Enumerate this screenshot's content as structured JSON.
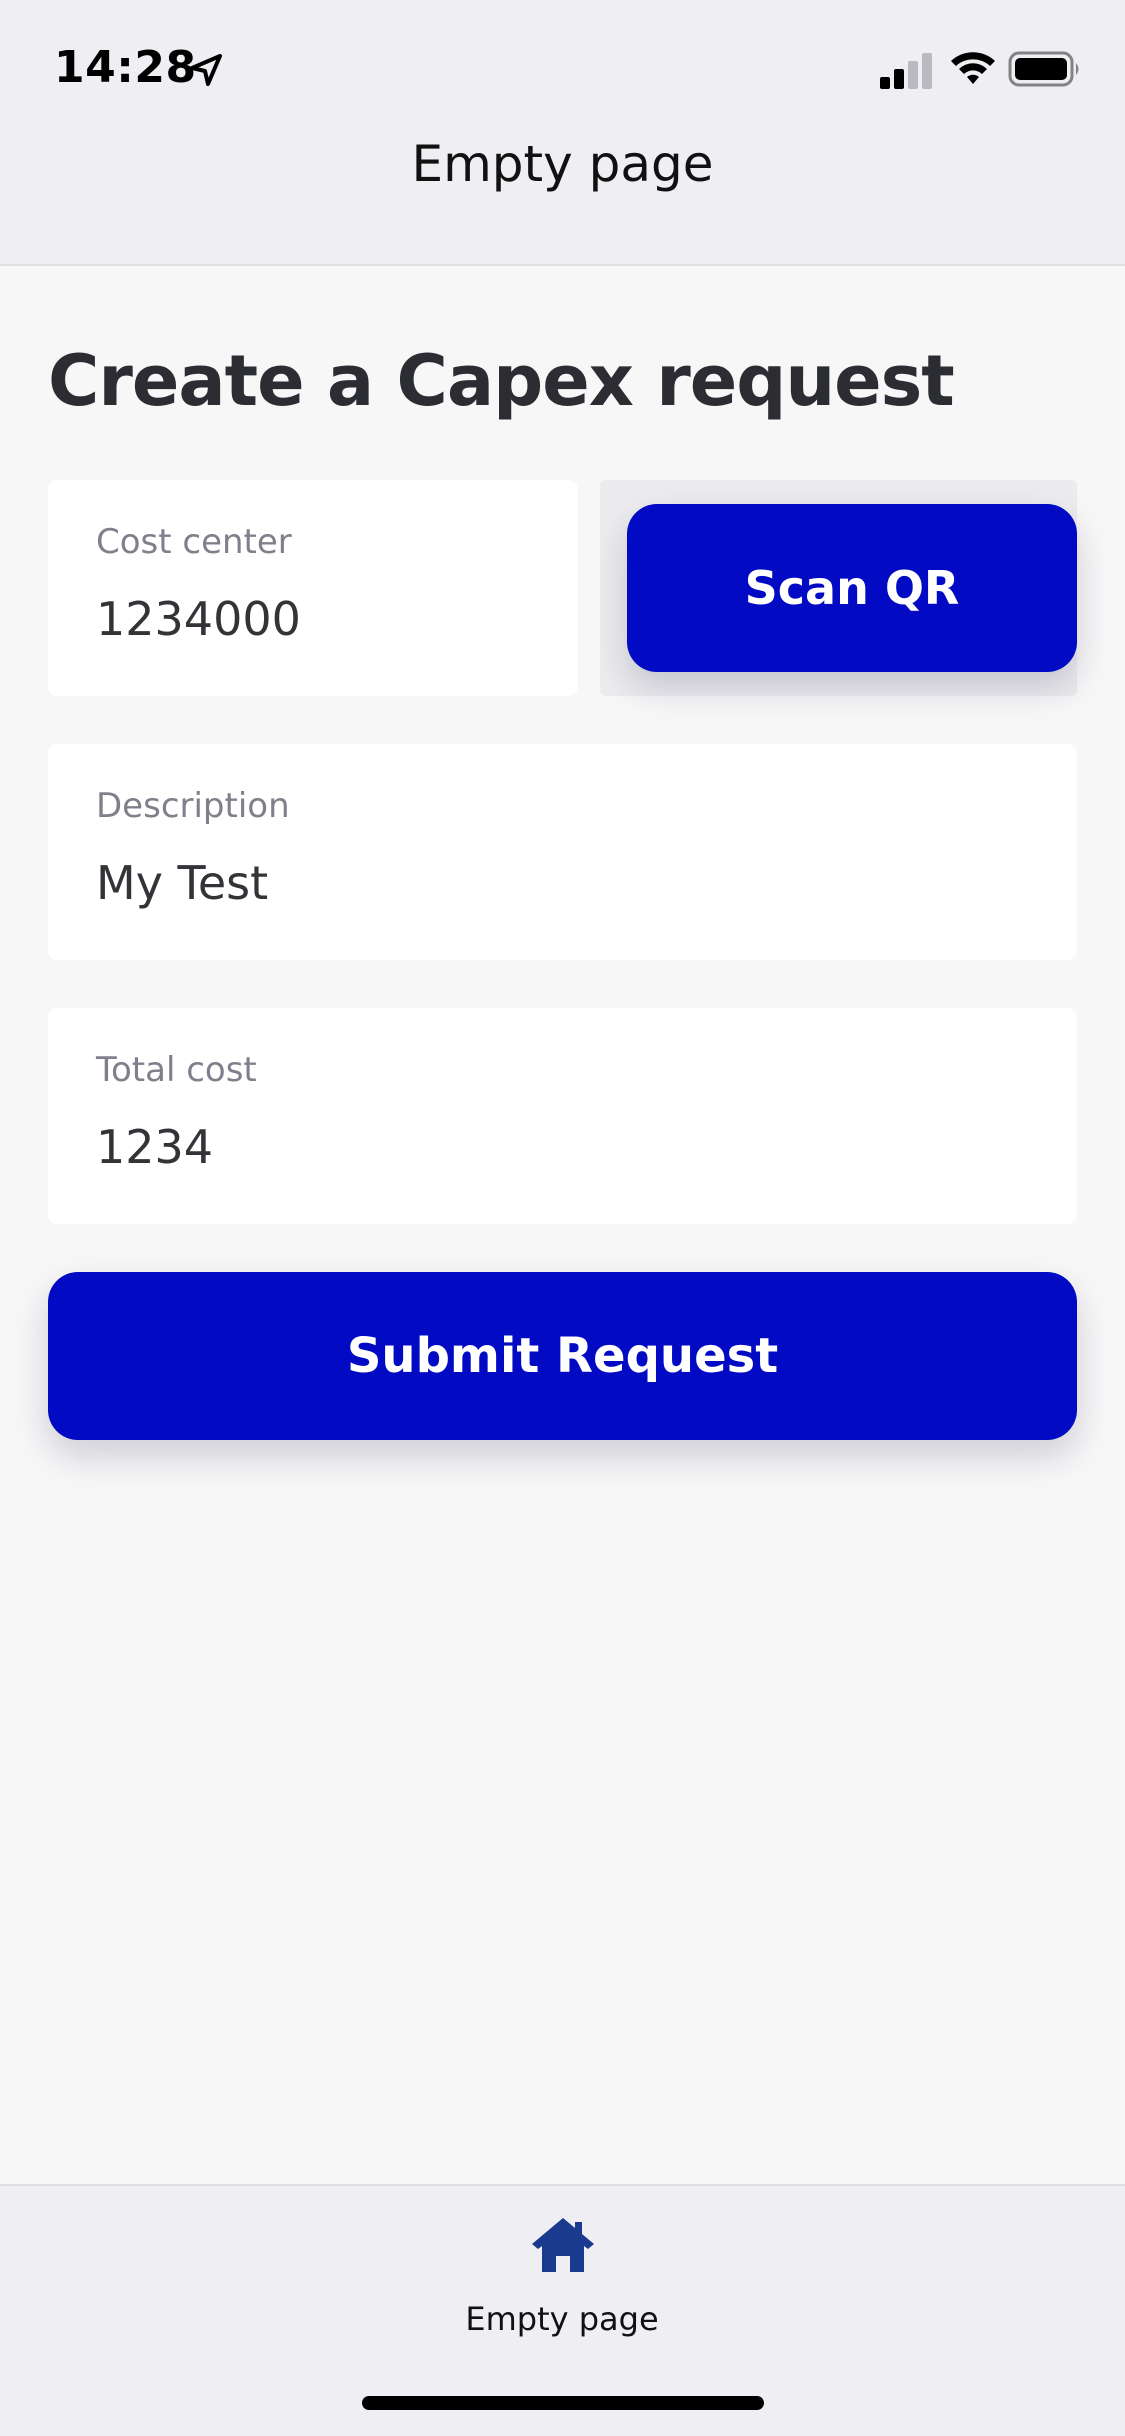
{
  "status_bar": {
    "time": "14:28",
    "icons": [
      "location-arrow-icon",
      "signal-icon",
      "wifi-icon",
      "battery-icon"
    ]
  },
  "header": {
    "title": "Empty page"
  },
  "main": {
    "title": "Create a Capex request",
    "cost_center": {
      "label": "Cost center",
      "value": "1234000"
    },
    "scan_button": {
      "label": "Scan QR"
    },
    "description": {
      "label": "Description",
      "value": "My Test"
    },
    "total_cost": {
      "label": "Total cost",
      "value": "1234"
    },
    "submit_button": {
      "label": "Submit Request"
    }
  },
  "tab_bar": {
    "items": [
      {
        "label": "Empty page",
        "icon": "home-icon",
        "selected": true
      }
    ]
  },
  "colors": {
    "accent": "#020bc3",
    "tab_icon": "#1a3a8f",
    "background": "#f7f7f8",
    "bar_background": "#efeff3"
  }
}
